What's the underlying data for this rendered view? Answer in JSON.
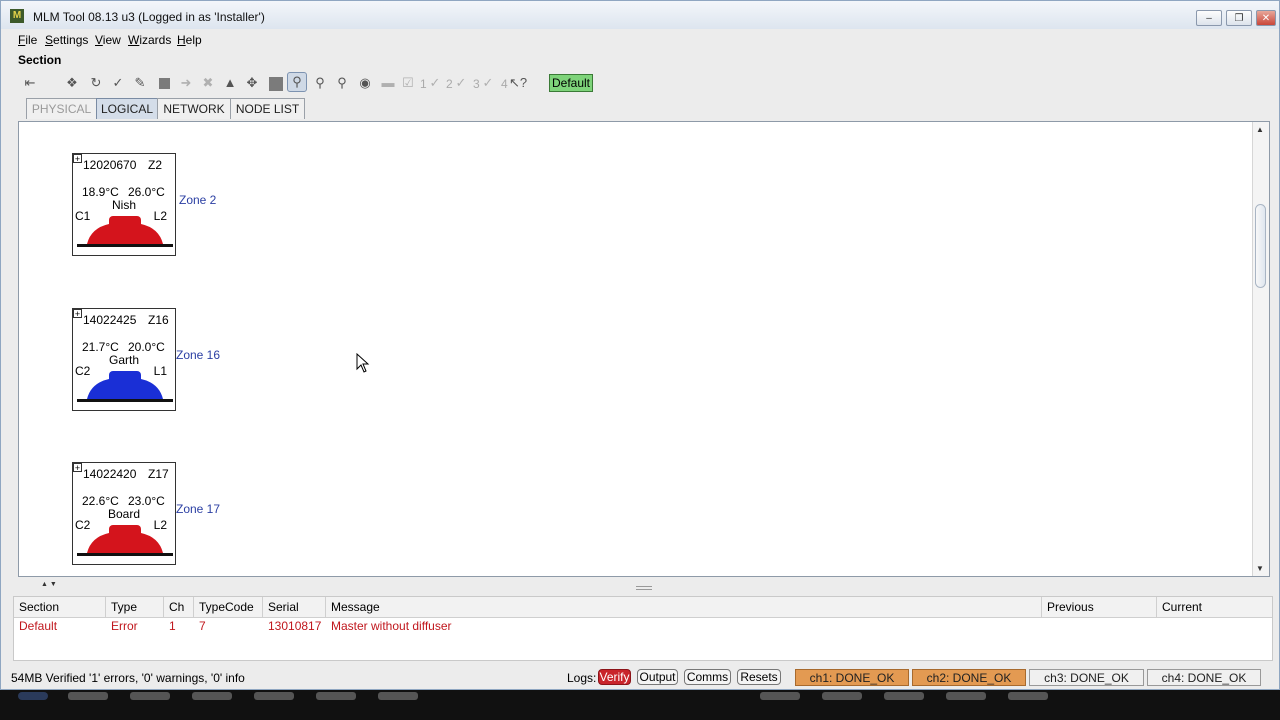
{
  "window": {
    "title": "MLM Tool 08.13 u3 (Logged in as 'Installer')",
    "app_icon_glyph": "M"
  },
  "menu": [
    {
      "label": "File",
      "mnemonic": "F",
      "rest": "ile"
    },
    {
      "label": "Settings",
      "mnemonic": "S",
      "rest": "ettings"
    },
    {
      "label": "View",
      "mnemonic": "V",
      "rest": "iew"
    },
    {
      "label": "Wizards",
      "mnemonic": "W",
      "rest": "izards"
    },
    {
      "label": "Help",
      "mnemonic": "H",
      "rest": "elp"
    }
  ],
  "section_label": "Section",
  "toolbar": {
    "numbers": [
      "1",
      "2",
      "3",
      "4"
    ],
    "default_button": "Default",
    "default_color": "#7ed37a"
  },
  "tabs": [
    {
      "label": "PHYSICAL",
      "state": "disabled"
    },
    {
      "label": "LOGICAL",
      "state": "selected"
    },
    {
      "label": "NETWORK",
      "state": "normal"
    },
    {
      "label": "NODE LIST",
      "state": "normal"
    }
  ],
  "nodes": [
    {
      "serial": "12020670",
      "zone_code": "Z2",
      "temp1": "18.9°C",
      "temp2": "26.0°C",
      "name": "Nish",
      "channel": "C1",
      "loop": "L2",
      "color": "#d4141c",
      "zone": "Zone 2"
    },
    {
      "serial": "14022425",
      "zone_code": "Z16",
      "temp1": "21.7°C",
      "temp2": "20.0°C",
      "name": "Garth",
      "channel": "C2",
      "loop": "L1",
      "color": "#1a2fd6",
      "zone": "Zone 16"
    },
    {
      "serial": "14022420",
      "zone_code": "Z17",
      "temp1": "22.6°C",
      "temp2": "23.0°C",
      "name": "Board",
      "channel": "C2",
      "loop": "L2",
      "color": "#d4141c",
      "zone": "Zone 17"
    }
  ],
  "messages": {
    "columns": [
      "Section",
      "Type",
      "Ch",
      "TypeCode",
      "Serial",
      "Message",
      "Previous",
      "Current"
    ],
    "rows": [
      {
        "section": "Default",
        "type": "Error",
        "ch": "1",
        "typecode": "7",
        "serial": "13010817",
        "message": "Master without diffuser",
        "previous": "",
        "current": ""
      }
    ],
    "error_color": "#c0171d"
  },
  "status": {
    "text": "54MB  Verified '1' errors, '0' warnings, '0' info",
    "logs_label": "Logs:",
    "log_buttons": [
      {
        "label": "Verify",
        "state": "alert"
      },
      {
        "label": "Output",
        "state": "normal"
      },
      {
        "label": "Comms",
        "state": "normal"
      },
      {
        "label": "Resets",
        "state": "normal"
      }
    ],
    "channels": [
      {
        "label": "ch1: DONE_OK",
        "state": "warn"
      },
      {
        "label": "ch2: DONE_OK",
        "state": "warn"
      },
      {
        "label": "ch3: DONE_OK",
        "state": "ok"
      },
      {
        "label": "ch4: DONE_OK",
        "state": "ok"
      }
    ]
  }
}
